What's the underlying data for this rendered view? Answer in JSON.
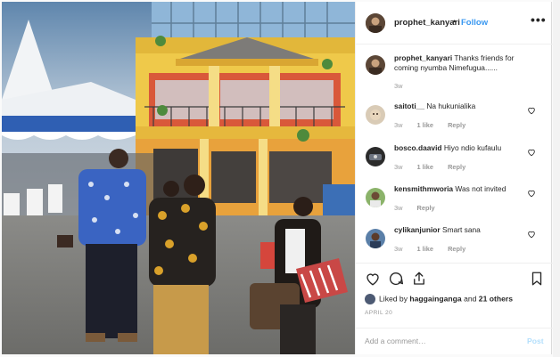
{
  "post": {
    "username": "prophet_kanyari",
    "separator": "•",
    "follow_label": "Follow",
    "more_icon": "more-icon",
    "caption": {
      "username": "prophet_kanyari",
      "text": "Thanks friends for coming nyumba Nimefugua......",
      "time": "3w"
    }
  },
  "comments": [
    {
      "username": "saitoti__",
      "text": "Na hukunialika",
      "time": "3w",
      "likes": "1 like",
      "reply": "Reply"
    },
    {
      "username": "bosco.daavid",
      "text": "Hiyo ndio kufaulu",
      "time": "3w",
      "likes": "1 like",
      "reply": "Reply"
    },
    {
      "username": "kensmithmworia",
      "text": "Was not invited",
      "time": "3w",
      "likes": "",
      "reply": "Reply"
    },
    {
      "username": "cylikanjunior",
      "text": "Smart sana",
      "time": "3w",
      "likes": "1 like",
      "reply": "Reply"
    }
  ],
  "actions": {
    "liked_by_prefix": "Liked by",
    "liked_by_user": "haggainganga",
    "liked_by_and": "and",
    "liked_by_others": "21 others",
    "date": "APRIL 20"
  },
  "comment_box": {
    "placeholder": "Add a comment…",
    "post_label": "Post"
  },
  "colors": {
    "follow": "#3897f0",
    "post_disabled": "#b2dffc",
    "muted": "#999999"
  }
}
